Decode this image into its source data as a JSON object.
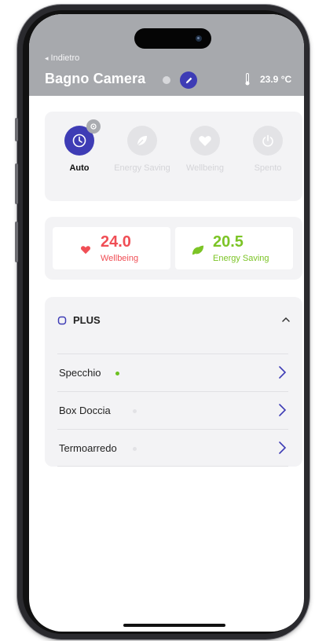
{
  "header": {
    "back_label": "Indietro",
    "room_name": "Bagno Camera",
    "temperature": "23.9 °C"
  },
  "modes": [
    {
      "label": "Auto",
      "icon": "clock-icon",
      "active": true
    },
    {
      "label": "Energy Saving",
      "icon": "leaf-icon",
      "active": false
    },
    {
      "label": "Wellbeing",
      "icon": "heart-icon",
      "active": false
    },
    {
      "label": "Spento",
      "icon": "power-icon",
      "active": false
    }
  ],
  "setpoints": {
    "wellbeing": {
      "value": "24.0",
      "label": "Wellbeing",
      "color": "#f04e55"
    },
    "energy_saving": {
      "value": "20.5",
      "label": "Energy Saving",
      "color": "#7cc426"
    }
  },
  "plus": {
    "title": "PLUS",
    "items": [
      {
        "label": "Specchio",
        "status_color": "#6cc020"
      },
      {
        "label": "Box Doccia",
        "status_color": "#e2e2e5"
      },
      {
        "label": "Termoarredo",
        "status_color": "#e2e2e5"
      }
    ]
  },
  "colors": {
    "accent": "#3e3cb5",
    "header_bg": "#a7a9ad"
  }
}
